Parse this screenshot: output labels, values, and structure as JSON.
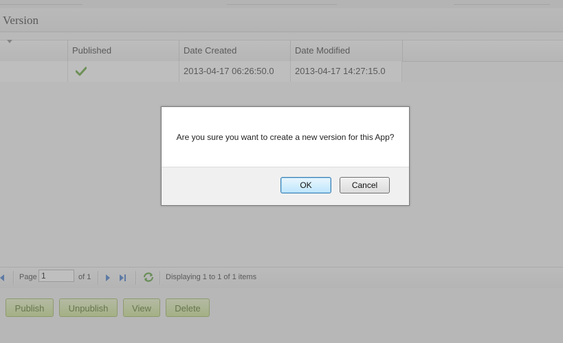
{
  "panel": {
    "title": "Version"
  },
  "grid": {
    "columns": [
      "Published",
      "Date Created",
      "Date Modified"
    ],
    "rows": [
      {
        "published_icon": "checkmark-icon",
        "date_created": "2013-04-17 06:26:50.0",
        "date_modified": "2013-04-17 14:27:15.0"
      }
    ]
  },
  "pager": {
    "page_label": "Page",
    "page_value": "1",
    "of_label": "of 1",
    "display_text": "Displaying 1 to 1 of 1 items"
  },
  "actions": {
    "publish": "Publish",
    "unpublish": "Unpublish",
    "view": "View",
    "delete": "Delete"
  },
  "dialog": {
    "message": "Are you sure you want to create a new version for this App?",
    "ok_label": "OK",
    "cancel_label": "Cancel"
  },
  "colors": {
    "accent": "#3a74c9",
    "action_button": "#c9e08c",
    "check": "#5aa02c"
  }
}
